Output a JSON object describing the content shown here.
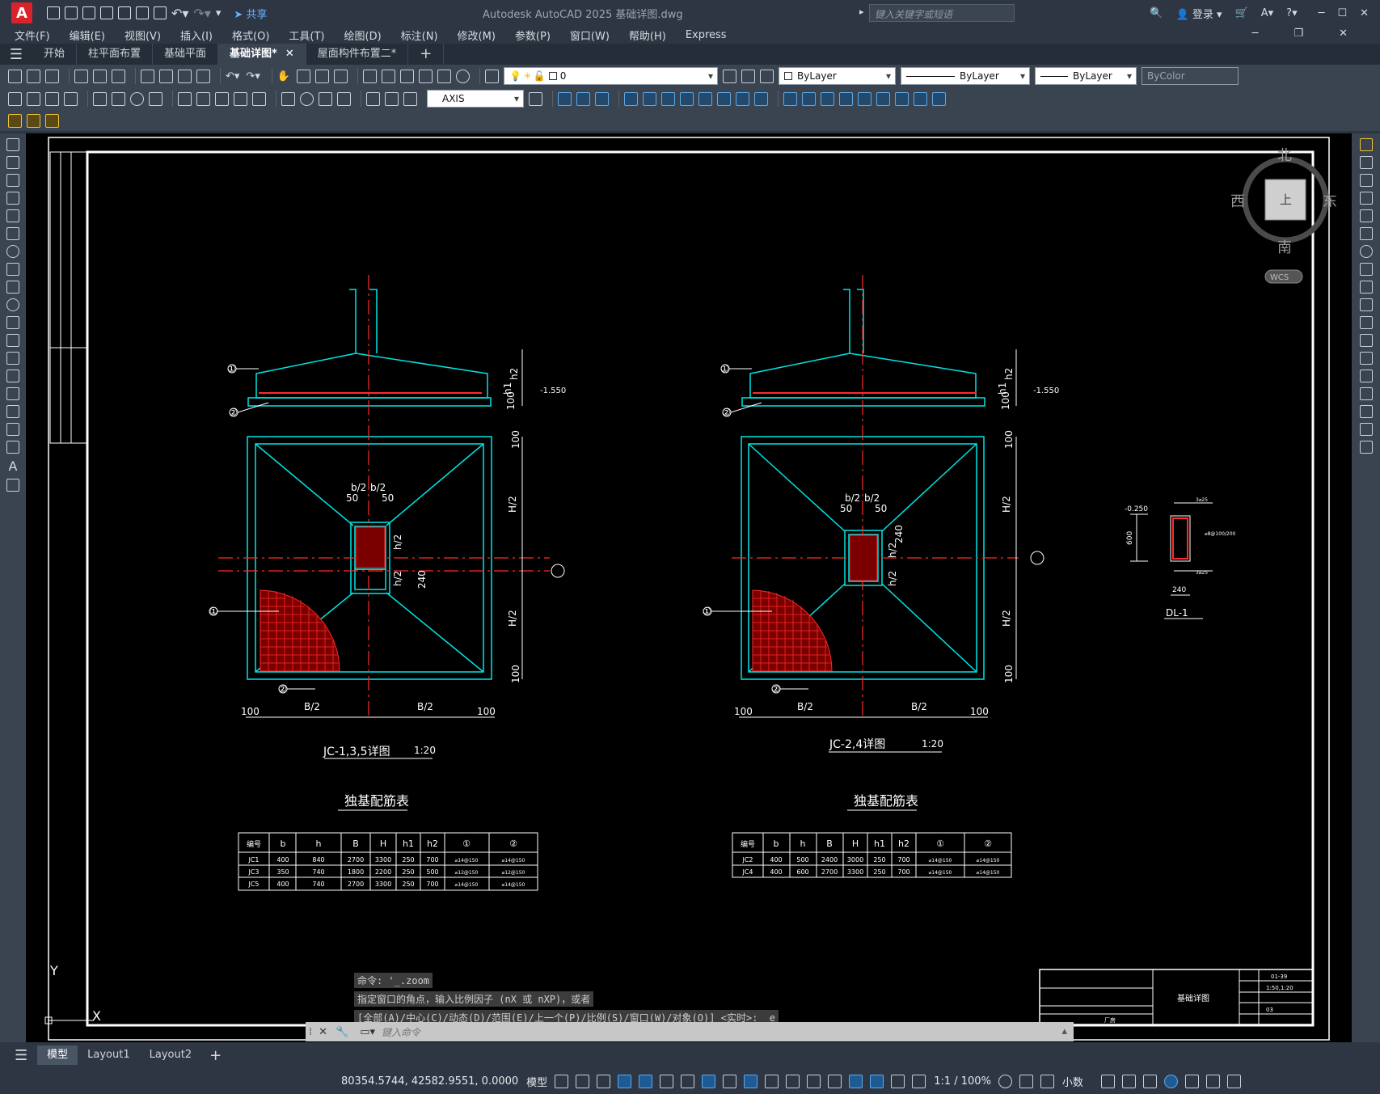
{
  "titlebar": {
    "share_label": "共享",
    "window_title": "Autodesk AutoCAD 2025    基础详图.dwg",
    "search_placeholder": "键入关键字或短语",
    "login_label": "登录"
  },
  "menu": [
    "文件(F)",
    "编辑(E)",
    "视图(V)",
    "插入(I)",
    "格式(O)",
    "工具(T)",
    "绘图(D)",
    "标注(N)",
    "修改(M)",
    "参数(P)",
    "窗口(W)",
    "帮助(H)",
    "Express"
  ],
  "tabs": [
    {
      "label": "开始",
      "active": false
    },
    {
      "label": "柱平面布置",
      "active": false
    },
    {
      "label": "基础平面",
      "active": false
    },
    {
      "label": "基础详图*",
      "active": true
    },
    {
      "label": "屋面构件布置二*",
      "active": false
    }
  ],
  "toolbar": {
    "layer_value": "0",
    "color_value": "ByLayer",
    "linetype_value": "ByLayer",
    "lineweight_value": "ByLayer",
    "plotstyle_value": "ByColor",
    "dimstyle_value": "AXIS"
  },
  "viewcube": {
    "north": "北",
    "south": "南",
    "east": "东",
    "west": "西",
    "top": "上",
    "wcs": "WCS"
  },
  "drawing": {
    "detail1": {
      "title": "JC-1,3,5详图",
      "scale": "1:20",
      "elevation": "-1.550",
      "dims": {
        "h2": "h2",
        "h1": "h1",
        "d100": "100",
        "b2": "b/2",
        "d50": "50",
        "h_half": "h/2",
        "d240": "240",
        "H_half": "H/2",
        "B_half": "B/2"
      },
      "marks": [
        "①",
        "②"
      ]
    },
    "detail2": {
      "title": "JC-2,4详图",
      "scale": "1:20",
      "elevation": "-1.550"
    },
    "beam": {
      "title": "DL-1",
      "elev": "-0.250",
      "height": "600",
      "width": "240",
      "top_bar": "3⌀25",
      "stirrup": "⌀8@100/200",
      "bot_bar": "3⌀25"
    },
    "table1": {
      "title": "独基配筋表",
      "headers": [
        "编号",
        "b",
        "h",
        "B",
        "H",
        "h1",
        "h2",
        "①",
        "②"
      ],
      "rows": [
        [
          "JC1",
          "400",
          "840",
          "2700",
          "3300",
          "250",
          "700",
          "⌀14@150",
          "⌀14@150"
        ],
        [
          "JC3",
          "350",
          "740",
          "1800",
          "2200",
          "250",
          "500",
          "⌀12@150",
          "⌀12@150"
        ],
        [
          "JC5",
          "400",
          "740",
          "2700",
          "3300",
          "250",
          "700",
          "⌀14@150",
          "⌀14@150"
        ]
      ]
    },
    "table2": {
      "title": "独基配筋表",
      "headers": [
        "编号",
        "b",
        "h",
        "B",
        "H",
        "h1",
        "h2",
        "①",
        "②"
      ],
      "rows": [
        [
          "JC2",
          "400",
          "500",
          "2400",
          "3000",
          "250",
          "700",
          "⌀14@150",
          "⌀14@150"
        ],
        [
          "JC4",
          "400",
          "600",
          "2700",
          "3300",
          "250",
          "700",
          "⌀14@150",
          "⌀14@150"
        ]
      ]
    },
    "titleblock": {
      "drawing_name": "基础详图",
      "drawing_no": "01-39",
      "scale": "1:50,1:20",
      "project": "厂房",
      "sheet": "03"
    }
  },
  "command": {
    "line1": "命令: '_.zoom",
    "line2": "指定窗口的角点，输入比例因子 (nX 或 nXP)，或者",
    "line3": "[全部(A)/中心(C)/动态(D)/范围(E)/上一个(P)/比例(S)/窗口(W)/对象(O)] <实时>: _e",
    "placeholder": "键入命令"
  },
  "layout_tabs": [
    {
      "label": "模型",
      "active": true
    },
    {
      "label": "Layout1",
      "active": false
    },
    {
      "label": "Layout2",
      "active": false
    }
  ],
  "status": {
    "coords": "80354.5744, 42582.9551, 0.0000",
    "mode": "模型",
    "scale": "1:1 / 100%",
    "units": "小数"
  }
}
